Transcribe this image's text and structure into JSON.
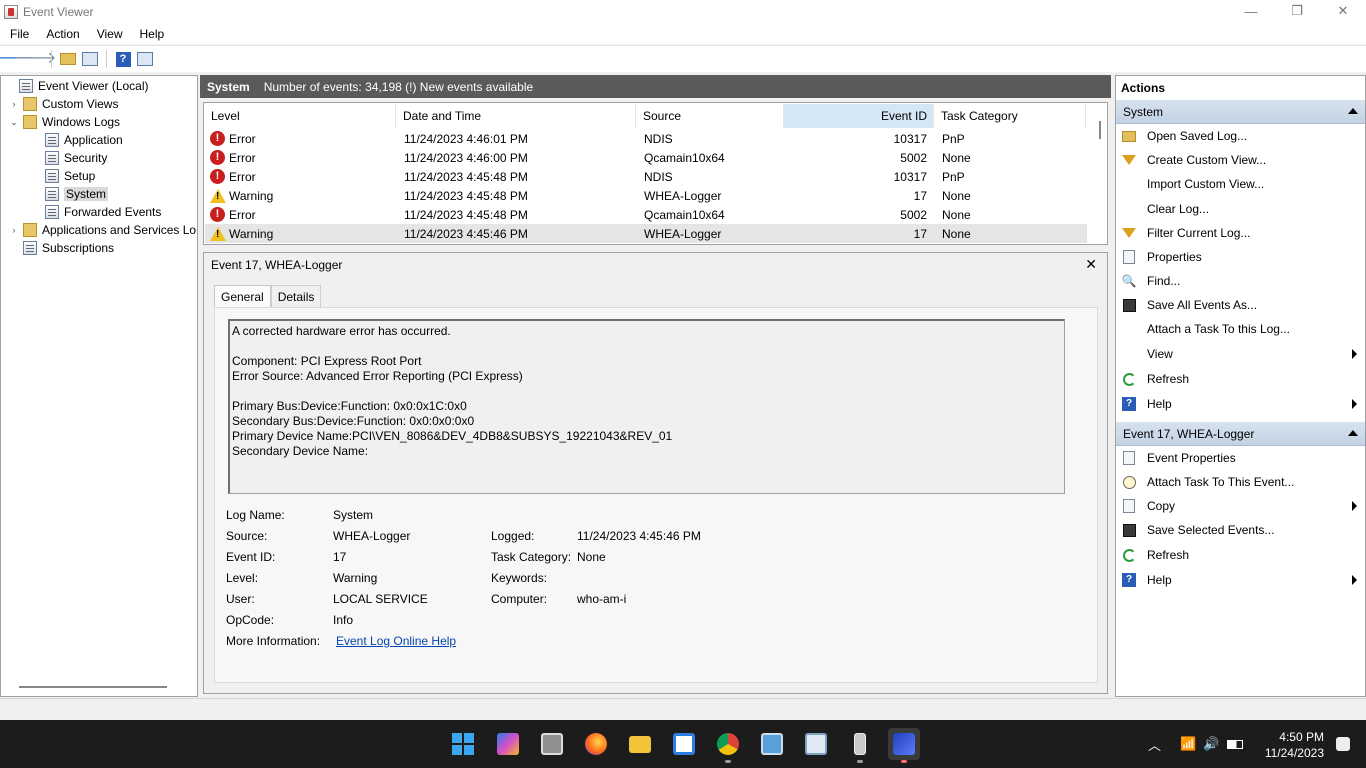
{
  "window": {
    "title": "Event Viewer",
    "controls": [
      "—",
      "❐",
      "✕"
    ]
  },
  "menu": [
    "File",
    "Action",
    "View",
    "Help"
  ],
  "tree": {
    "items": [
      {
        "label": "Event Viewer (Local)",
        "expander": "",
        "icon": "event-viewer-icon"
      },
      {
        "label": "Custom Views",
        "expander": "›",
        "icon": "folder-icon"
      },
      {
        "label": "Windows Logs",
        "expander": "⌄",
        "icon": "folder-icon"
      },
      {
        "label": "Application",
        "expander": "",
        "icon": "log-icon"
      },
      {
        "label": "Security",
        "expander": "",
        "icon": "log-icon"
      },
      {
        "label": "Setup",
        "expander": "",
        "icon": "log-icon"
      },
      {
        "label": "System",
        "expander": "",
        "icon": "log-icon"
      },
      {
        "label": "Forwarded Events",
        "expander": "",
        "icon": "log-icon"
      },
      {
        "label": "Applications and Services Lo",
        "expander": "›",
        "icon": "folder-icon"
      },
      {
        "label": "Subscriptions",
        "expander": "",
        "icon": "subscriptions-icon"
      }
    ]
  },
  "center": {
    "title": "System",
    "summary": "Number of events: 34,198 (!) New events available"
  },
  "events": {
    "columns": [
      "Level",
      "Date and Time",
      "Source",
      "Event ID",
      "Task Category"
    ],
    "rows": [
      {
        "level": "Error",
        "date": "11/24/2023 4:46:01 PM",
        "source": "NDIS",
        "id": "10317",
        "category": "PnP"
      },
      {
        "level": "Error",
        "date": "11/24/2023 4:46:00 PM",
        "source": "Qcamain10x64",
        "id": "5002",
        "category": "None"
      },
      {
        "level": "Error",
        "date": "11/24/2023 4:45:48 PM",
        "source": "NDIS",
        "id": "10317",
        "category": "PnP"
      },
      {
        "level": "Warning",
        "date": "11/24/2023 4:45:48 PM",
        "source": "WHEA-Logger",
        "id": "17",
        "category": "None"
      },
      {
        "level": "Error",
        "date": "11/24/2023 4:45:48 PM",
        "source": "Qcamain10x64",
        "id": "5002",
        "category": "None"
      },
      {
        "level": "Warning",
        "date": "11/24/2023 4:45:46 PM",
        "source": "WHEA-Logger",
        "id": "17",
        "category": "None"
      }
    ]
  },
  "detail": {
    "title": "Event 17, WHEA-Logger",
    "close": "✕",
    "tabs": [
      "General",
      "Details"
    ],
    "description": [
      "A corrected hardware error has occurred.",
      "",
      "Component: PCI Express Root Port",
      "Error Source: Advanced Error Reporting (PCI Express)",
      "",
      "Primary Bus:Device:Function: 0x0:0x1C:0x0",
      "Secondary Bus:Device:Function: 0x0:0x0:0x0",
      "Primary Device Name:PCI\\VEN_8086&DEV_4DB8&SUBSYS_19221043&REV_01",
      "Secondary Device Name:"
    ],
    "props": {
      "log_name_label": "Log Name:",
      "log_name": "System",
      "source_label": "Source:",
      "source": "WHEA-Logger",
      "logged_label": "Logged:",
      "logged": "11/24/2023 4:45:46 PM",
      "event_id_label": "Event ID:",
      "event_id": "17",
      "task_cat_label": "Task Category:",
      "task_cat": "None",
      "level_label": "Level:",
      "level": "Warning",
      "keywords_label": "Keywords:",
      "keywords": "",
      "user_label": "User:",
      "user": "LOCAL SERVICE",
      "computer_label": "Computer:",
      "computer": "who-am-i",
      "opcode_label": "OpCode:",
      "opcode": "Info",
      "more_info_label": "More Information:",
      "more_info_link": "Event Log Online Help"
    }
  },
  "actions": {
    "title": "Actions",
    "section1": "System",
    "items1": [
      {
        "label": "Open Saved Log...",
        "icon": "folder-icon",
        "submenu": false
      },
      {
        "label": "Create Custom View...",
        "icon": "filter-icon",
        "submenu": false
      },
      {
        "label": "Import Custom View...",
        "icon": "",
        "submenu": false
      },
      {
        "label": "Clear Log...",
        "icon": "",
        "submenu": false
      },
      {
        "label": "Filter Current Log...",
        "icon": "filter-icon",
        "submenu": false
      },
      {
        "label": "Properties",
        "icon": "properties-icon",
        "submenu": false
      },
      {
        "label": "Find...",
        "icon": "find-icon",
        "submenu": false
      },
      {
        "label": "Save All Events As...",
        "icon": "save-icon",
        "submenu": false
      },
      {
        "label": "Attach a Task To this Log...",
        "icon": "",
        "submenu": false
      },
      {
        "label": "View",
        "icon": "",
        "submenu": true
      },
      {
        "label": "Refresh",
        "icon": "refresh-icon",
        "submenu": false
      },
      {
        "label": "Help",
        "icon": "help-icon",
        "submenu": true
      }
    ],
    "section2": "Event 17, WHEA-Logger",
    "items2": [
      {
        "label": "Event Properties",
        "icon": "properties-icon",
        "submenu": false
      },
      {
        "label": "Attach Task To This Event...",
        "icon": "task-icon",
        "submenu": false
      },
      {
        "label": "Copy",
        "icon": "copy-icon",
        "submenu": true
      },
      {
        "label": "Save Selected Events...",
        "icon": "save-icon",
        "submenu": false
      },
      {
        "label": "Refresh",
        "icon": "refresh-icon",
        "submenu": false
      },
      {
        "label": "Help",
        "icon": "help-icon",
        "submenu": true
      }
    ]
  },
  "taskbar": {
    "time": "4:50 PM",
    "date": "11/24/2023"
  }
}
